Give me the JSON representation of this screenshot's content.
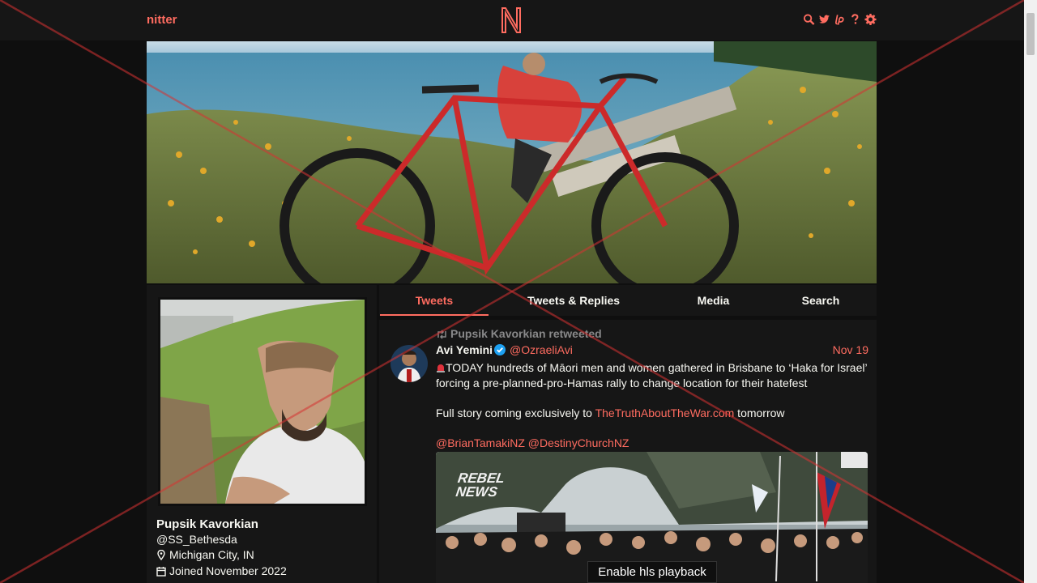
{
  "nav": {
    "site_name": "nitter",
    "logo_letter": "N",
    "icons": [
      "search-icon",
      "twitter-icon",
      "liberapay-icon",
      "help-icon",
      "settings-icon"
    ],
    "accent": "#ff6c60"
  },
  "profile": {
    "fullname": "Pupsik Kavorkian",
    "username": "@SS_Bethesda",
    "location": "Michigan City, IN",
    "joined": "Joined November 2022"
  },
  "tabs": [
    "Tweets",
    "Tweets & Replies",
    "Media",
    "Search"
  ],
  "active_tab": "Tweets",
  "tweet": {
    "retweet_label": "Pupsik Kavorkian retweeted",
    "fullname": "Avi Yemini",
    "handle": "@OzraeliAvi",
    "date": "Nov 19",
    "text_line1": "TODAY hundreds of Māori men and women gathered in Brisbane to ‘Haka for Israel’ forcing a pre-planned-pro-Hamas rally to change location for their hatefest",
    "text_line2_prefix": "Full story coming exclusively to ",
    "text_line2_link": "TheTruthAboutTheWar.com",
    "text_line2_suffix": " tomorrow",
    "mention1": "@BrianTamakiNZ",
    "mention2": "@DestinyChurchNZ",
    "media_watermark": "REBEL NEWS",
    "hls_button": "Enable hls playback"
  }
}
